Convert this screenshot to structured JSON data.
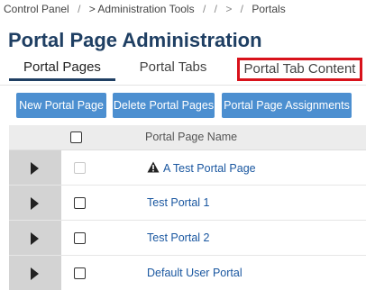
{
  "breadcrumb": {
    "items": [
      "Control Panel",
      "/",
      "> Administration Tools",
      "/",
      "/",
      ">",
      "/",
      "Portals"
    ]
  },
  "page_title": "Portal Page Administration",
  "tabs": [
    {
      "label": "Portal Pages",
      "active": true
    },
    {
      "label": "Portal Tabs",
      "active": false
    },
    {
      "label": "Portal Tab Content",
      "active": false,
      "highlighted": true
    }
  ],
  "toolbar": {
    "new_label": "New Portal Page",
    "delete_label": "Delete Portal Pages",
    "assign_label": "Portal Page Assignments"
  },
  "table": {
    "column_name": "Portal Page Name",
    "rows": [
      {
        "name": "A Test Portal Page",
        "warning": true,
        "checkbox_disabled": true
      },
      {
        "name": "Test Portal 1",
        "warning": false,
        "checkbox_disabled": false
      },
      {
        "name": "Test Portal 2",
        "warning": false,
        "checkbox_disabled": false
      },
      {
        "name": "Default User Portal",
        "warning": false,
        "checkbox_disabled": false
      }
    ]
  },
  "colors": {
    "title": "#1f3f63",
    "button": "#4c8fd0",
    "link": "#1a57a0",
    "highlight": "#d8121b"
  },
  "icons": [
    "expand-arrow-icon",
    "warning-icon"
  ]
}
